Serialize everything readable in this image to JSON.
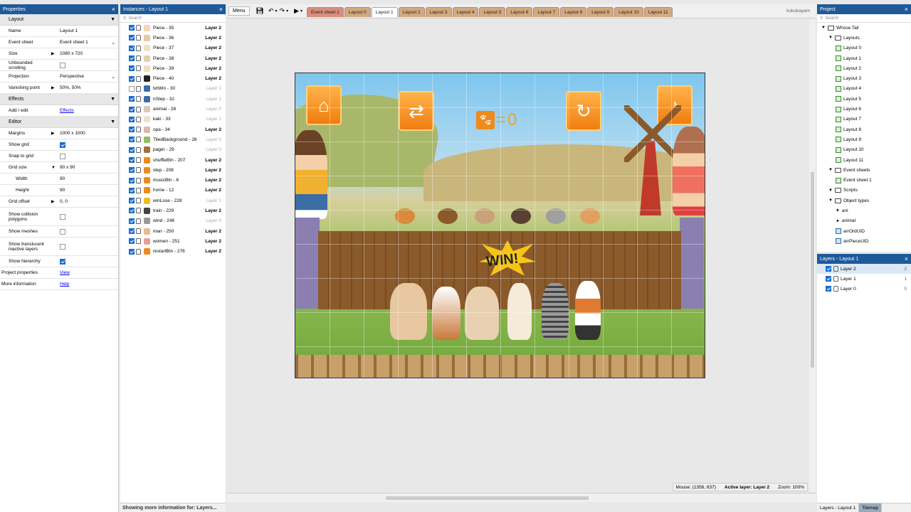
{
  "properties": {
    "title": "Properties",
    "sections": {
      "layout": "Layout",
      "effects": "Effects",
      "editor": "Editor"
    },
    "rows": {
      "name": {
        "label": "Name",
        "value": "Layout 1"
      },
      "event_sheet": {
        "label": "Event sheet",
        "value": "Event sheet 1"
      },
      "size": {
        "label": "Size",
        "value": "1080 x 720"
      },
      "unbounded": {
        "label": "Unbounded scrolling"
      },
      "projection": {
        "label": "Projection",
        "value": "Perspective"
      },
      "vanishing": {
        "label": "Vanishing point",
        "value": "50%, 50%"
      },
      "add_edit": {
        "label": "Add / edit",
        "value": "Effects"
      },
      "margins": {
        "label": "Margins",
        "value": "1000 x 1000"
      },
      "show_grid": {
        "label": "Show grid"
      },
      "snap": {
        "label": "Snap to grid"
      },
      "grid_size": {
        "label": "Grid size",
        "value": "90 x 90"
      },
      "width": {
        "label": "Width",
        "value": "90"
      },
      "height": {
        "label": "Height",
        "value": "90"
      },
      "grid_offset": {
        "label": "Grid offset",
        "value": "0, 0"
      },
      "collision": {
        "label": "Show collision polygons"
      },
      "meshes": {
        "label": "Show meshes"
      },
      "translucent": {
        "label": "Show translucent inactive layers"
      },
      "hierarchy": {
        "label": "Show hierarchy"
      },
      "project_props": {
        "label": "Project properties",
        "value": "View"
      },
      "more_info": {
        "label": "More information",
        "value": "Help"
      }
    }
  },
  "instances": {
    "title": "Instances - Layout 1",
    "search_placeholder": "Search",
    "footer": "Showing more information for: Layers...",
    "items": [
      {
        "name": "Piece - 35",
        "layer": "Layer 2",
        "color": "#f4d6b0"
      },
      {
        "name": "Piece - 36",
        "layer": "Layer 2",
        "color": "#e8c8a0"
      },
      {
        "name": "Piece - 37",
        "layer": "Layer 2",
        "color": "#f0e0c8"
      },
      {
        "name": "Piece - 38",
        "layer": "Layer 2",
        "color": "#e0d0b0"
      },
      {
        "name": "Piece - 39",
        "layer": "Layer 2",
        "color": "#f0e0c0"
      },
      {
        "name": "Piece - 40",
        "layer": "Layer 2",
        "color": "#222222"
      },
      {
        "name": "txtWin - 30",
        "layer": "Layer 1",
        "color": "#3a6ea5"
      },
      {
        "name": "nStep - 32",
        "layer": "Layer 1",
        "color": "#3a6ea5"
      },
      {
        "name": "animal - 28",
        "layer": "Layer 0",
        "color": "#d8c8b8"
      },
      {
        "name": "kaki - 33",
        "layer": "Layer 1",
        "color": "#f0e0d0"
      },
      {
        "name": "opa - 34",
        "layer": "Layer 2",
        "color": "#d8b8a8"
      },
      {
        "name": "TiledBackground - 26",
        "layer": "Layer 0",
        "color": "#8cc060"
      },
      {
        "name": "pager - 29",
        "layer": "Layer 0",
        "color": "#a07040"
      },
      {
        "name": "shuffleBtn - 207",
        "layer": "Layer 2",
        "color": "#f08a1a"
      },
      {
        "name": "step - 208",
        "layer": "Layer 2",
        "color": "#f08a1a"
      },
      {
        "name": "musicBtn - 6",
        "layer": "Layer 2",
        "color": "#f08a1a"
      },
      {
        "name": "home - 12",
        "layer": "Layer 2",
        "color": "#f08a1a"
      },
      {
        "name": "winLose - 228",
        "layer": "Layer 1",
        "color": "#e8c020"
      },
      {
        "name": "train - 229",
        "layer": "Layer 2",
        "color": "#444444"
      },
      {
        "name": "wind - 248",
        "layer": "Layer 0",
        "color": "#999999"
      },
      {
        "name": "man - 250",
        "layer": "Layer 2",
        "color": "#e8b890"
      },
      {
        "name": "women - 251",
        "layer": "Layer 2",
        "color": "#e8a090"
      },
      {
        "name": "restartBtn - 276",
        "layer": "Layer 2",
        "color": "#f08a1a"
      }
    ]
  },
  "toolbar": {
    "menu": "Menu",
    "tabs": [
      {
        "label": "Event sheet 1",
        "kind": "sheet"
      },
      {
        "label": "Layout 0",
        "kind": "layout"
      },
      {
        "label": "Layout 1",
        "kind": "active"
      },
      {
        "label": "Layout 2",
        "kind": "layout"
      },
      {
        "label": "Layout 3",
        "kind": "layout"
      },
      {
        "label": "Layout 4",
        "kind": "layout"
      },
      {
        "label": "Layout 5",
        "kind": "layout"
      },
      {
        "label": "Layout 6",
        "kind": "layout"
      },
      {
        "label": "Layout 7",
        "kind": "layout"
      },
      {
        "label": "Layout 8",
        "kind": "layout"
      },
      {
        "label": "Layout 9",
        "kind": "layout"
      },
      {
        "label": "Layout 10",
        "kind": "layout"
      },
      {
        "label": "Layout 11",
        "kind": "layout"
      }
    ],
    "user": "kokokayam"
  },
  "game": {
    "score": "0",
    "win_text": "WIN!"
  },
  "status": {
    "mouse": "Mouse: (1356, 837)",
    "layer": "Active layer: Layer 2",
    "zoom": "Zoom: 100%"
  },
  "project": {
    "title": "Project",
    "search_placeholder": "Search",
    "tree": [
      {
        "label": "Whose Tail",
        "indent": 0,
        "type": "folder"
      },
      {
        "label": "Layouts",
        "indent": 1,
        "type": "folder"
      },
      {
        "label": "Layout 0",
        "indent": 2,
        "type": "layout"
      },
      {
        "label": "Layout 1",
        "indent": 2,
        "type": "layout"
      },
      {
        "label": "Layout 2",
        "indent": 2,
        "type": "layout"
      },
      {
        "label": "Layout 3",
        "indent": 2,
        "type": "layout"
      },
      {
        "label": "Layout 4",
        "indent": 2,
        "type": "layout"
      },
      {
        "label": "Layout 5",
        "indent": 2,
        "type": "layout"
      },
      {
        "label": "Layout 6",
        "indent": 2,
        "type": "layout"
      },
      {
        "label": "Layout 7",
        "indent": 2,
        "type": "layout"
      },
      {
        "label": "Layout 8",
        "indent": 2,
        "type": "layout"
      },
      {
        "label": "Layout 9",
        "indent": 2,
        "type": "layout"
      },
      {
        "label": "Layout 10",
        "indent": 2,
        "type": "layout"
      },
      {
        "label": "Layout 11",
        "indent": 2,
        "type": "layout"
      },
      {
        "label": "Event sheets",
        "indent": 1,
        "type": "folder"
      },
      {
        "label": "Event sheet 1",
        "indent": 2,
        "type": "layout"
      },
      {
        "label": "Scripts",
        "indent": 1,
        "type": "folder"
      },
      {
        "label": "Object types",
        "indent": 1,
        "type": "folder"
      },
      {
        "label": "ani",
        "indent": 2,
        "type": "object"
      },
      {
        "label": "animal",
        "indent": 2,
        "type": "object"
      },
      {
        "label": "arrOrdUID",
        "indent": 2,
        "type": "array"
      },
      {
        "label": "arrPieceUID",
        "indent": 2,
        "type": "array"
      }
    ]
  },
  "layers": {
    "title": "Layers - Layout 1",
    "items": [
      {
        "label": "Layer 2",
        "num": "2",
        "selected": true
      },
      {
        "label": "Layer 1",
        "num": "1",
        "selected": false
      },
      {
        "label": "Layer 0",
        "num": "0",
        "selected": false
      }
    ],
    "tabs": [
      "Layers - Layout 1",
      "Tilemap"
    ]
  }
}
